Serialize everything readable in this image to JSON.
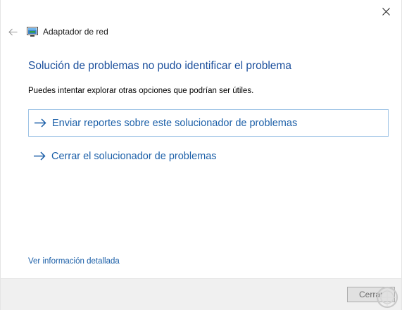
{
  "window": {
    "title": "Adaptador de red",
    "close_glyph": "close-icon",
    "back_glyph": "back-arrow-icon",
    "app_icon": "network-adapter-icon"
  },
  "main": {
    "heading": "Solución de problemas no pudo identificar el problema",
    "subtext": "Puedes intentar explorar otras opciones que podrían ser útiles.",
    "options": [
      {
        "label": "Enviar reportes sobre este solucionador de problemas",
        "icon": "arrow-right-icon",
        "focused": true
      },
      {
        "label": "Cerrar el solucionador de problemas",
        "icon": "arrow-right-icon",
        "focused": false
      }
    ],
    "details_link": "Ver información detallada"
  },
  "footer": {
    "close_label": "Cerrar"
  },
  "colors": {
    "heading": "#1b4f9c",
    "link": "#1b5fa8",
    "focus_border": "#9fc4e6",
    "footer_bg": "#f0f0f0",
    "watermark": "#d7d7d7"
  }
}
